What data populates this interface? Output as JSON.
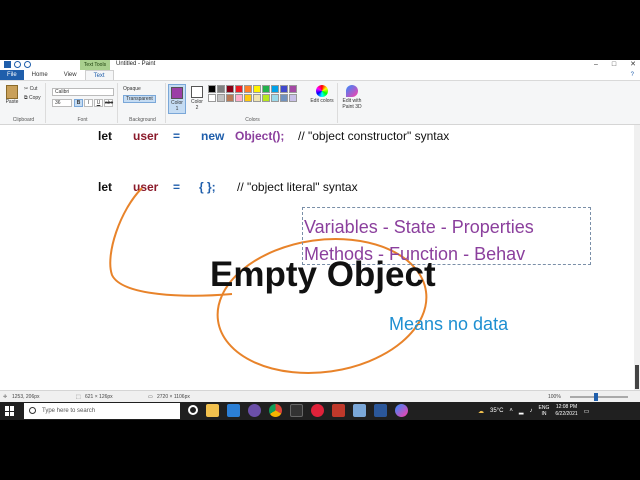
{
  "window": {
    "title": "Untitled - Paint",
    "contextual_tab": "Text Tools",
    "controls": {
      "minimize": "–",
      "maximize": "□",
      "close": "✕"
    }
  },
  "tabs": [
    {
      "label": "File"
    },
    {
      "label": "Home"
    },
    {
      "label": "View"
    },
    {
      "label": "Text",
      "active": true
    }
  ],
  "ribbon": {
    "clipboard": {
      "paste": "Paste",
      "cut": "Cut",
      "copy": "Copy",
      "label": "Clipboard"
    },
    "font": {
      "family": "Calibri",
      "size": "36",
      "bold": "B",
      "italic": "I",
      "underline": "U",
      "strike": "abc",
      "label": "Font"
    },
    "background": {
      "opaque": "Opaque",
      "transparent": "Transparent",
      "label": "Background"
    },
    "colors": {
      "color1": "Color 1",
      "color2": "Color 2",
      "label": "Colors",
      "edit": "Edit colors",
      "color1_value": "#9b3fa6",
      "color2_value": "#ffffff",
      "palette": [
        "#000000",
        "#7f7f7f",
        "#880015",
        "#ed1c24",
        "#ff7f27",
        "#fff200",
        "#22b14c",
        "#00a2e8",
        "#3f48cc",
        "#a349a4",
        "#ffffff",
        "#c3c3c3",
        "#b97a57",
        "#ffaec9",
        "#ffc90e",
        "#efe4b0",
        "#b5e61d",
        "#99d9ea",
        "#7092be",
        "#c8bfe7"
      ]
    },
    "paint3d": {
      "label": "Edit with Paint 3D"
    }
  },
  "canvas": {
    "line1": {
      "let": "let",
      "user": "user",
      "eq": "=",
      "new": "new",
      "ctor": "Object();",
      "comment": "// \"object constructor\" syntax"
    },
    "line2": {
      "let": "let",
      "user": "user",
      "eq": "=",
      "braces": "{ };",
      "comment": "// \"object literal\" syntax"
    },
    "annotation_line1": "Variables  - State - Properties",
    "annotation_line2": "Methods   -  Function  -  Behav",
    "empty_object": "Empty  Object",
    "means_no_data": "Means   no   data"
  },
  "statusbar": {
    "cursor": "1253, 206px",
    "selection": "621 × 126px",
    "canvas_size": "2720 × 1106px",
    "zoom": "100%"
  },
  "taskbar": {
    "search_placeholder": "Type here to search",
    "temperature": "35°C",
    "language_line1": "ENG",
    "language_line2": "IN",
    "time": "12:08 PM",
    "date": "6/22/2021"
  }
}
